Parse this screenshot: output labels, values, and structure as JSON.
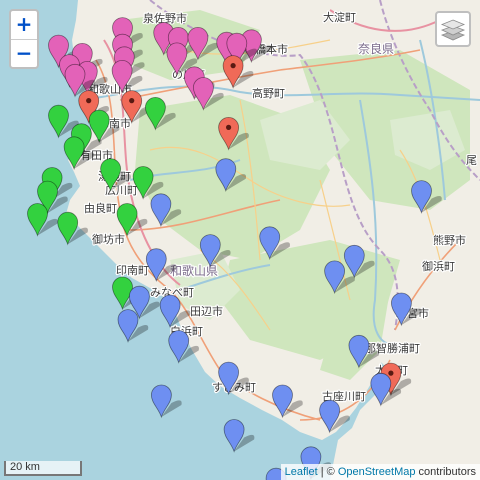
{
  "map": {
    "zoom_in_label": "+",
    "zoom_out_label": "−",
    "layers_icon": "layers-icon",
    "scale_label": "20 km",
    "attribution": {
      "leaflet": "Leaflet",
      "separator": " | © ",
      "osm": "OpenStreetMap",
      "suffix": " contributors"
    },
    "place_labels": [
      {
        "id": "izumisano",
        "text": "泉佐野市"
      },
      {
        "id": "hashimoto",
        "text": "橋本市"
      },
      {
        "id": "oyodo",
        "text": "大淀町"
      },
      {
        "id": "nara",
        "text": "奈良県"
      },
      {
        "id": "wakayama",
        "text": "和歌山市"
      },
      {
        "id": "kinokawa",
        "text": "の川市"
      },
      {
        "id": "koya",
        "text": "高野町"
      },
      {
        "id": "kainan",
        "text": "海南市"
      },
      {
        "id": "arida",
        "text": "有田市"
      },
      {
        "id": "yuasa",
        "text": "湯浅町"
      },
      {
        "id": "hirogawa",
        "text": "広川町"
      },
      {
        "id": "yura",
        "text": "由良町"
      },
      {
        "id": "gobo",
        "text": "御坊市"
      },
      {
        "id": "inami",
        "text": "印南町"
      },
      {
        "id": "wakayama_pref",
        "text": "和歌山県"
      },
      {
        "id": "minabe",
        "text": "みなべ町"
      },
      {
        "id": "tanabe",
        "text": "田辺市"
      },
      {
        "id": "shirahama",
        "text": "白浜町"
      },
      {
        "id": "susami",
        "text": "すさみ町"
      },
      {
        "id": "kozagawa",
        "text": "古座川町"
      },
      {
        "id": "kumanogawa",
        "text": "熊野市"
      },
      {
        "id": "mihama",
        "text": "御浜町"
      },
      {
        "id": "shingu",
        "text": "新宮市"
      },
      {
        "id": "nachikatsuura",
        "text": "那智勝浦町"
      },
      {
        "id": "taiji",
        "text": "太地町"
      },
      {
        "id": "owase",
        "text": "尾"
      }
    ],
    "marker_colors": {
      "pink": "#e362b8",
      "green": "#33d13f",
      "blue": "#6e8ff1",
      "red": "#f06a58"
    },
    "markers": [
      {
        "color": "pink",
        "lat": 34.398,
        "lon": 135.318
      },
      {
        "color": "pink",
        "lat": 34.388,
        "lon": 135.408
      },
      {
        "color": "pink",
        "lat": 34.378,
        "lon": 135.44
      },
      {
        "color": "pink",
        "lat": 34.378,
        "lon": 135.483
      },
      {
        "color": "pink",
        "lat": 34.368,
        "lon": 135.546
      },
      {
        "color": "pink",
        "lat": 34.366,
        "lon": 135.568
      },
      {
        "color": "pink",
        "lat": 34.373,
        "lon": 135.6
      },
      {
        "color": "pink",
        "lat": 34.362,
        "lon": 135.178
      },
      {
        "color": "pink",
        "lat": 34.364,
        "lon": 135.318
      },
      {
        "color": "pink",
        "lat": 34.345,
        "lon": 135.23
      },
      {
        "color": "pink",
        "lat": 34.338,
        "lon": 135.322
      },
      {
        "color": "pink",
        "lat": 34.346,
        "lon": 135.437
      },
      {
        "color": "pink",
        "lat": 34.322,
        "lon": 135.202
      },
      {
        "color": "pink",
        "lat": 34.302,
        "lon": 135.214
      },
      {
        "color": "pink",
        "lat": 34.308,
        "lon": 135.241
      },
      {
        "color": "pink",
        "lat": 34.31,
        "lon": 135.317
      },
      {
        "color": "pink",
        "lat": 34.297,
        "lon": 135.475
      },
      {
        "color": "pink",
        "lat": 34.275,
        "lon": 135.495
      },
      {
        "color": "red",
        "lat": 34.32,
        "lon": 135.56
      },
      {
        "color": "red",
        "lat": 34.248,
        "lon": 135.244
      },
      {
        "color": "red",
        "lat": 34.248,
        "lon": 135.338
      },
      {
        "color": "red",
        "lat": 34.193,
        "lon": 135.55
      },
      {
        "color": "red",
        "lat": 33.688,
        "lon": 135.905
      },
      {
        "color": "green",
        "lat": 34.234,
        "lon": 135.39
      },
      {
        "color": "green",
        "lat": 34.218,
        "lon": 135.178
      },
      {
        "color": "green",
        "lat": 34.208,
        "lon": 135.267
      },
      {
        "color": "green",
        "lat": 34.18,
        "lon": 135.228
      },
      {
        "color": "green",
        "lat": 34.153,
        "lon": 135.212
      },
      {
        "color": "green",
        "lat": 34.108,
        "lon": 135.292
      },
      {
        "color": "green",
        "lat": 34.092,
        "lon": 135.363
      },
      {
        "color": "green",
        "lat": 34.09,
        "lon": 135.164
      },
      {
        "color": "green",
        "lat": 34.062,
        "lon": 135.154
      },
      {
        "color": "green",
        "lat": 34.016,
        "lon": 135.132
      },
      {
        "color": "green",
        "lat": 34.016,
        "lon": 135.328
      },
      {
        "color": "green",
        "lat": 33.998,
        "lon": 135.198
      },
      {
        "color": "green",
        "lat": 33.865,
        "lon": 135.318
      },
      {
        "color": "blue",
        "lat": 34.108,
        "lon": 135.544
      },
      {
        "color": "blue",
        "lat": 34.063,
        "lon": 135.972
      },
      {
        "color": "blue",
        "lat": 34.036,
        "lon": 135.402
      },
      {
        "color": "blue",
        "lat": 33.968,
        "lon": 135.64
      },
      {
        "color": "blue",
        "lat": 33.952,
        "lon": 135.51
      },
      {
        "color": "blue",
        "lat": 33.923,
        "lon": 135.392
      },
      {
        "color": "blue",
        "lat": 33.93,
        "lon": 135.825
      },
      {
        "color": "blue",
        "lat": 33.898,
        "lon": 135.782
      },
      {
        "color": "blue",
        "lat": 33.846,
        "lon": 135.355
      },
      {
        "color": "blue",
        "lat": 33.828,
        "lon": 135.422
      },
      {
        "color": "blue",
        "lat": 33.832,
        "lon": 135.928
      },
      {
        "color": "blue",
        "lat": 33.798,
        "lon": 135.33
      },
      {
        "color": "blue",
        "lat": 33.755,
        "lon": 135.441
      },
      {
        "color": "blue",
        "lat": 33.745,
        "lon": 135.835
      },
      {
        "color": "blue",
        "lat": 33.69,
        "lon": 135.55
      },
      {
        "color": "blue",
        "lat": 33.667,
        "lon": 135.883
      },
      {
        "color": "blue",
        "lat": 33.643,
        "lon": 135.403
      },
      {
        "color": "blue",
        "lat": 33.643,
        "lon": 135.668
      },
      {
        "color": "blue",
        "lat": 33.612,
        "lon": 135.771
      },
      {
        "color": "blue",
        "lat": 33.572,
        "lon": 135.562
      },
      {
        "color": "blue",
        "lat": 33.516,
        "lon": 135.73
      },
      {
        "color": "blue",
        "lat": 33.472,
        "lon": 135.654
      }
    ]
  }
}
